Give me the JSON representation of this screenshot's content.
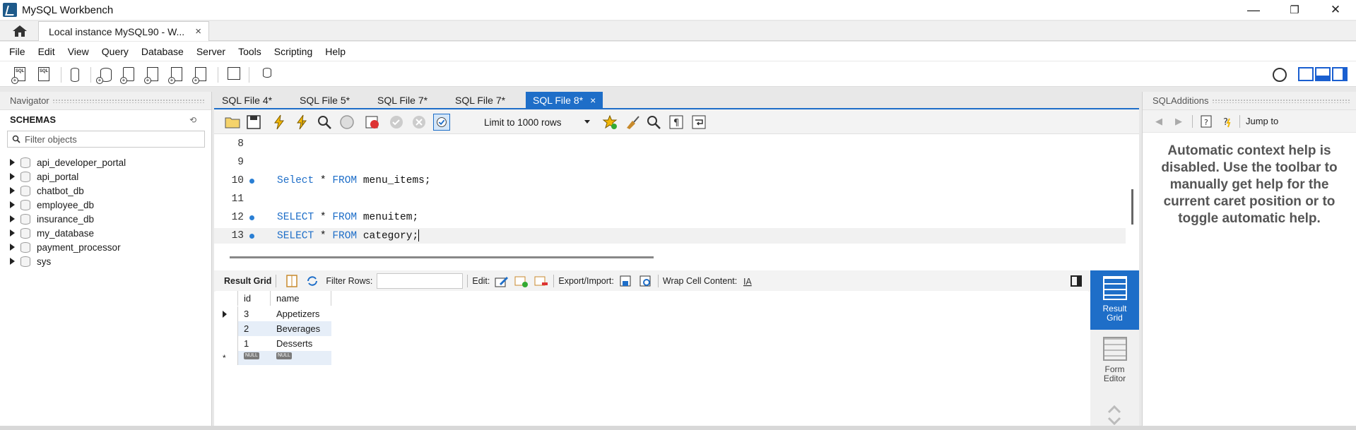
{
  "window": {
    "title": "MySQL Workbench",
    "minimize": "—",
    "restore": "❐",
    "close": "✕"
  },
  "connection_tab": {
    "label": "Local instance MySQL90 - W...",
    "close": "×"
  },
  "menu": [
    "File",
    "Edit",
    "View",
    "Query",
    "Database",
    "Server",
    "Tools",
    "Scripting",
    "Help"
  ],
  "navigator": {
    "header": "Navigator",
    "section_title": "SCHEMAS",
    "filter_placeholder": "Filter objects",
    "schemas": [
      "api_developer_portal",
      "api_portal",
      "chatbot_db",
      "employee_db",
      "insurance_db",
      "my_database",
      "payment_processor",
      "sys"
    ]
  },
  "file_tabs": [
    "SQL File 4*",
    "SQL File 5*",
    "SQL File 7*",
    "SQL File 7*",
    "SQL File 8*"
  ],
  "active_file_tab_close": "×",
  "editor_toolbar": {
    "limit_label": "Limit to 1000 rows"
  },
  "editor": {
    "lines": [
      {
        "num": "8",
        "has_dot": false,
        "kw1": "",
        "rest": ""
      },
      {
        "num": "9",
        "has_dot": false,
        "kw1": "",
        "rest": ""
      },
      {
        "num": "10",
        "has_dot": true,
        "kw1": "Select",
        "mid": " * ",
        "kw2": "FROM",
        "rest": " menu_items;"
      },
      {
        "num": "11",
        "has_dot": false,
        "kw1": "",
        "rest": ""
      },
      {
        "num": "12",
        "has_dot": true,
        "kw1": "SELECT",
        "mid": " * ",
        "kw2": "FROM",
        "rest": " menuitem;"
      },
      {
        "num": "13",
        "has_dot": true,
        "kw1": "SELECT",
        "mid": " * ",
        "kw2": "FROM",
        "rest": " category;"
      }
    ]
  },
  "result_toolbar": {
    "result_grid": "Result Grid",
    "filter_rows": "Filter Rows:",
    "edit": "Edit:",
    "export_import": "Export/Import:",
    "wrap": "Wrap Cell Content:"
  },
  "result_grid": {
    "columns": [
      "id",
      "name"
    ],
    "rows": [
      {
        "id": "3",
        "name": "Appetizers"
      },
      {
        "id": "2",
        "name": "Beverages"
      },
      {
        "id": "1",
        "name": "Desserts"
      }
    ],
    "new_row_marker": "*",
    "null_label": "NULL"
  },
  "side_buttons": {
    "result_grid_line1": "Result",
    "result_grid_line2": "Grid",
    "form_editor_line1": "Form",
    "form_editor_line2": "Editor"
  },
  "sql_additions": {
    "header": "SQLAdditions",
    "jump_to": "Jump to",
    "help_text": "Automatic context help is disabled. Use the toolbar to manually get help for the current caret position or to toggle automatic help."
  },
  "colors": {
    "accent": "#1e6ec8",
    "keyword": "#1e6ec8"
  }
}
